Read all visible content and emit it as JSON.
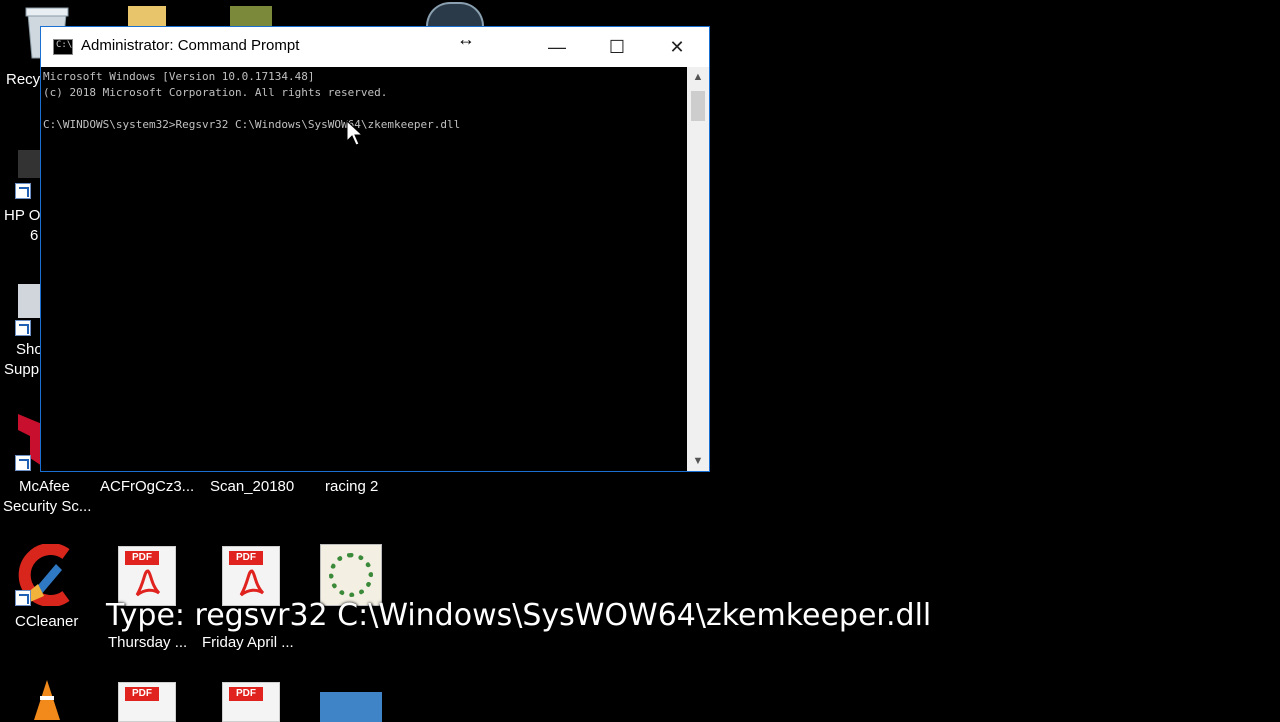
{
  "window": {
    "title": "Administrator: Command Prompt",
    "icon_text": "C:\\",
    "minimize_symbol": "—",
    "maximize_symbol": "☐",
    "close_symbol": "✕",
    "resize_symbol": "↔",
    "console_lines": [
      "Microsoft Windows [Version 10.0.17134.48]",
      "(c) 2018 Microsoft Corporation. All rights reserved.",
      "",
      "C:\\WINDOWS\\system32>Regsvr32 C:\\Windows\\SysWOW64\\zkemkeeper.dll"
    ]
  },
  "desktop": {
    "icons": {
      "recycle_bin": "Recy",
      "hp_line1": "HP O",
      "hp_line2": "6",
      "shortcut_line1": "Sho",
      "shortcut_line2": "Supp",
      "mcafee_line1": "McAfee",
      "mcafee_line2": "Security Sc...",
      "acfr": "ACFrOgCz3...",
      "scan": "Scan_20180",
      "racing": "racing 2",
      "ccleaner": "CCleaner",
      "pdf1_line2": "Thursday ...",
      "pdf2_line2": "Friday April ...",
      "pdf_tag": "PDF"
    }
  },
  "caption": "Type: regsvr32 C:\\Windows\\SysWOW64\\zkemkeeper.dll"
}
